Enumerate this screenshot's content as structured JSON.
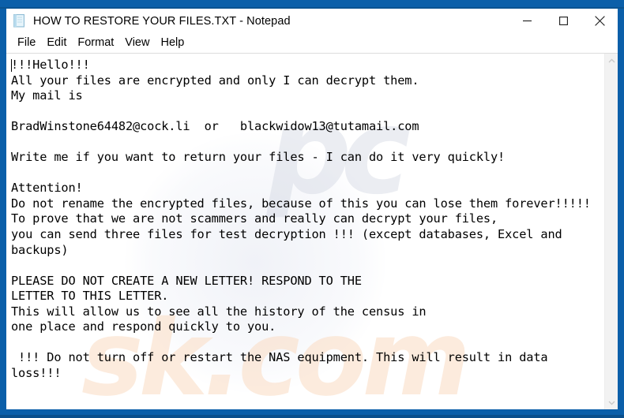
{
  "window": {
    "title": "HOW TO RESTORE YOUR FILES.TXT - Notepad",
    "app_icon": "notepad-document-icon",
    "accent_color": "#0b5fa9",
    "controls": {
      "minimize": "minimize-icon",
      "maximize": "maximize-icon",
      "close": "close-icon"
    }
  },
  "menubar": {
    "items": [
      {
        "label": "File"
      },
      {
        "label": "Edit"
      },
      {
        "label": "Format"
      },
      {
        "label": "View"
      },
      {
        "label": "Help"
      }
    ]
  },
  "editor": {
    "content": "!!!Hello!!!\nAll your files are encrypted and only I can decrypt them.\nMy mail is\n\nBradWinstone64482@cock.li  or   blackwidow13@tutamail.com\n\nWrite me if you want to return your files - I can do it very quickly!\n\nAttention!\nDo not rename the encrypted files, because of this you can lose them forever!!!!!\nTo prove that we are not scammers and really can decrypt your files,\nyou can send three files for test decryption !!! (except databases, Excel and\nbackups)\n\nPLEASE DO NOT CREATE A NEW LETTER! RESPOND TO THE\nLETTER TO THIS LETTER.\nThis will allow us to see all the history of the census in\none place and respond quickly to you.\n\n !!! Do not turn off or restart the NAS equipment. This will result in data\nloss!!!",
    "caret_visible": true,
    "watermark_top": "pc",
    "watermark_bottom": "sk.com"
  },
  "scrollbar": {
    "up_arrow": "scroll-up-arrow-icon",
    "down_arrow": "scroll-down-arrow-icon"
  }
}
